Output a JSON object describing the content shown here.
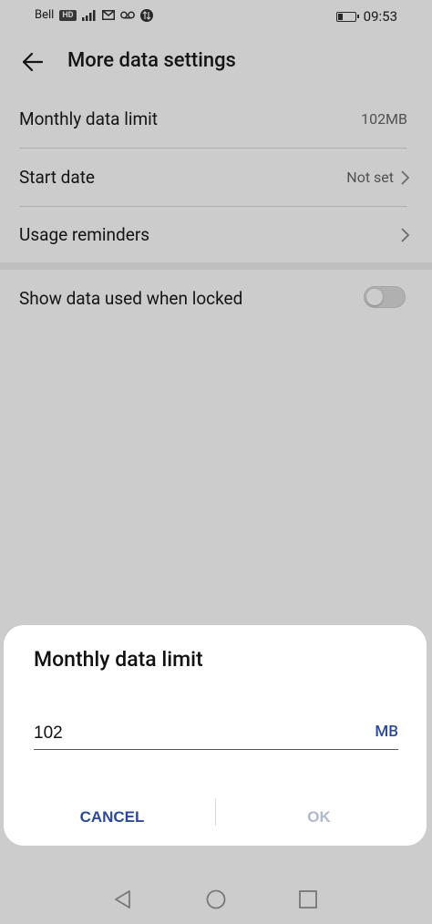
{
  "status_bar": {
    "carrier": "Bell",
    "network_badge": "HD",
    "time": "09:53",
    "icons": [
      "signal-icon",
      "message-icon",
      "voicemail-icon",
      "data-icon",
      "battery-icon"
    ]
  },
  "header": {
    "title": "More data settings"
  },
  "settings": {
    "monthly_limit": {
      "label": "Monthly data limit",
      "value": "102MB"
    },
    "start_date": {
      "label": "Start date",
      "value": "Not set"
    },
    "usage_reminders": {
      "label": "Usage reminders"
    },
    "show_locked": {
      "label": "Show data used when locked",
      "enabled": false
    }
  },
  "dialog": {
    "title": "Monthly data limit",
    "input_value": "102",
    "unit": "MB",
    "cancel_label": "CANCEL",
    "ok_label": "OK"
  },
  "colors": {
    "accent": "#2b4a9a",
    "disabled": "#b0b8cc"
  }
}
